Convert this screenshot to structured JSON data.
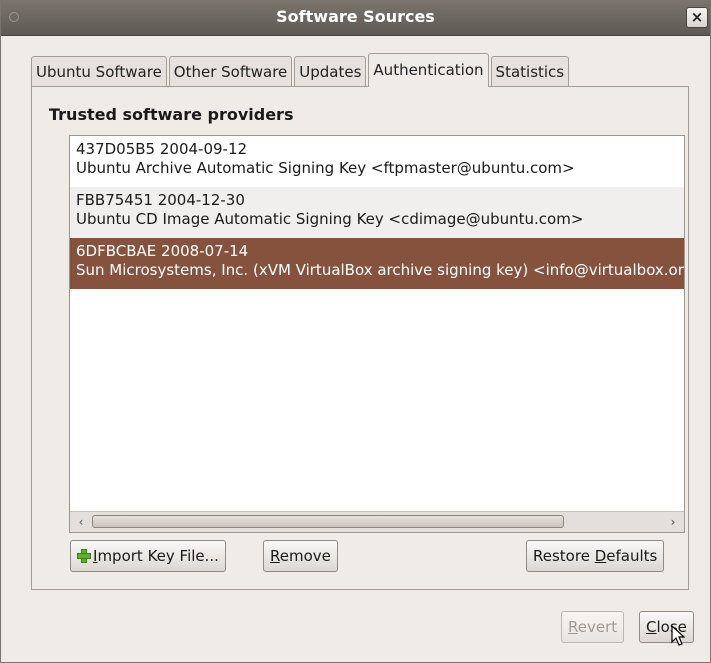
{
  "window": {
    "title": "Software Sources"
  },
  "tabs": [
    {
      "label": "Ubuntu Software"
    },
    {
      "label": "Other Software"
    },
    {
      "label": "Updates"
    },
    {
      "label": "Authentication",
      "active": true
    },
    {
      "label": "Statistics"
    }
  ],
  "section": {
    "label": "Trusted software providers"
  },
  "keys": [
    {
      "id_date": "437D05B5 2004-09-12",
      "description": "Ubuntu Archive Automatic Signing Key <ftpmaster@ubuntu.com>"
    },
    {
      "id_date": "FBB75451 2004-12-30",
      "description": "Ubuntu CD Image Automatic Signing Key <cdimage@ubuntu.com>"
    },
    {
      "id_date": "6DFBCBAE 2008-07-14",
      "description": "Sun Microsystems, Inc. (xVM VirtualBox archive signing key) <info@virtualbox.org>",
      "selected": true
    }
  ],
  "buttons": {
    "import_prefix": "",
    "import_mnemonic": "I",
    "import_rest": "mport Key File...",
    "remove_mnemonic": "R",
    "remove_rest": "emove",
    "restore_prefix": "Restore ",
    "restore_mnemonic": "D",
    "restore_rest": "efaults",
    "revert_mnemonic": "R",
    "revert_rest": "evert",
    "close_mnemonic": "C",
    "close_rest": "lose"
  },
  "colors": {
    "selection": "#85533d",
    "titlebar": "#5e5953",
    "window_bg": "#efebe7"
  }
}
